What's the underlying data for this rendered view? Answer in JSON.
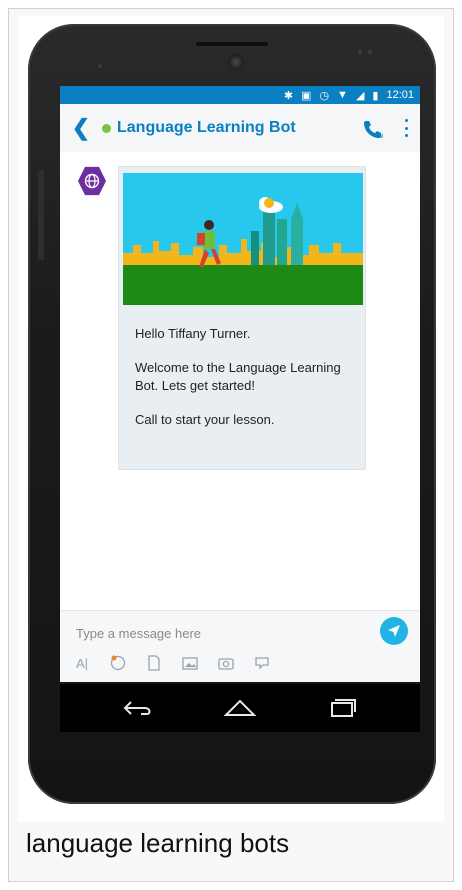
{
  "statusbar": {
    "time": "12:01"
  },
  "appbar": {
    "title": "Language Learning Bot",
    "presence": "online"
  },
  "message": {
    "lines": [
      "Hello Tiffany Turner.",
      "Welcome to the Language Learning Bot. Lets get started!",
      "Call to start your lesson."
    ]
  },
  "composer": {
    "placeholder": "Type a message here"
  },
  "caption": "language learning bots",
  "colors": {
    "accent": "#0a7fc1",
    "presence": "#7cc142",
    "send": "#22b3e6",
    "bot_avatar": "#6b2fa0",
    "hero_sky": "#27c7ee",
    "hero_ground": "#1e8a16",
    "hero_skyline": "#f2b61c"
  },
  "icons": {
    "status": [
      "bluetooth-icon",
      "vibrate-icon",
      "alarm-icon",
      "wifi-icon",
      "signal-icon",
      "battery-icon"
    ],
    "tools": [
      "text-format-icon",
      "emoji-icon",
      "file-icon",
      "image-icon",
      "camera-icon",
      "location-icon"
    ],
    "nav": [
      "back-nav-icon",
      "home-nav-icon",
      "recents-nav-icon"
    ]
  }
}
